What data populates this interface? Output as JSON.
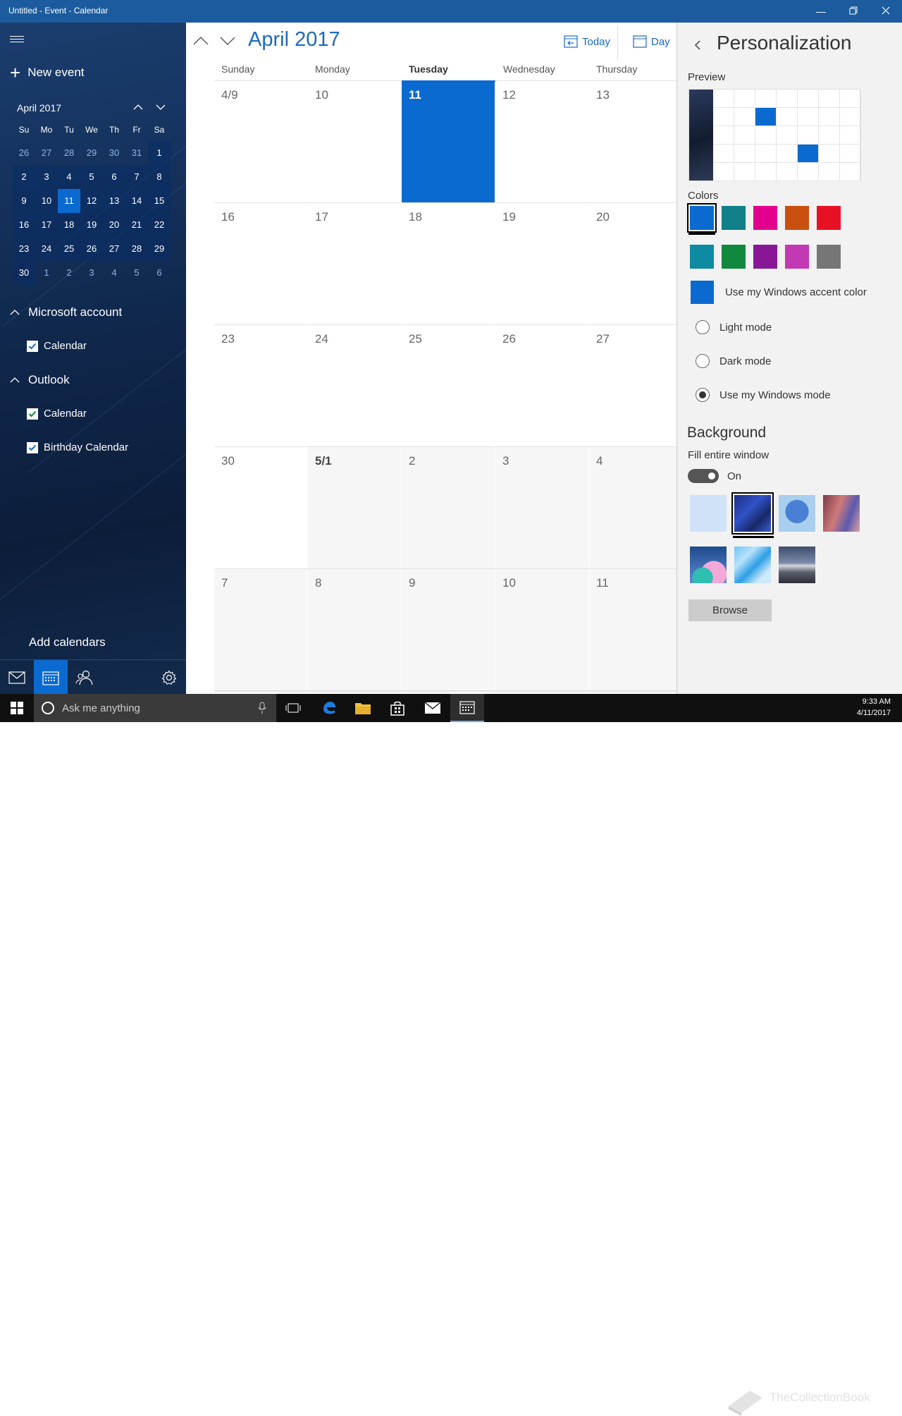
{
  "window": {
    "title": "Untitled - Event - Calendar"
  },
  "sidebar": {
    "new_event": "New event",
    "mini_month": "April 2017",
    "dows": [
      "Su",
      "Mo",
      "Tu",
      "We",
      "Th",
      "Fr",
      "Sa"
    ],
    "days": [
      "26",
      "27",
      "28",
      "29",
      "30",
      "31",
      "1",
      "2",
      "3",
      "4",
      "5",
      "6",
      "7",
      "8",
      "9",
      "10",
      "11",
      "12",
      "13",
      "14",
      "15",
      "16",
      "17",
      "18",
      "19",
      "20",
      "21",
      "22",
      "23",
      "24",
      "25",
      "26",
      "27",
      "28",
      "29",
      "30",
      "1",
      "2",
      "3",
      "4",
      "5",
      "6"
    ],
    "selected_day": "11",
    "accounts": [
      {
        "name": "Microsoft account",
        "calendars": [
          "Calendar"
        ]
      },
      {
        "name": "Outlook",
        "calendars": [
          "Calendar",
          "Birthday Calendar"
        ]
      }
    ],
    "add_calendars": "Add calendars"
  },
  "main": {
    "month_title": "April 2017",
    "today_label": "Today",
    "day_label": "Day",
    "dows": [
      "Sunday",
      "Monday",
      "Tuesday",
      "Wednesday",
      "Thursday"
    ],
    "current_dow": "Tuesday",
    "weeks": [
      [
        "4/9",
        "10",
        "11",
        "12",
        "13"
      ],
      [
        "16",
        "17",
        "18",
        "19",
        "20"
      ],
      [
        "23",
        "24",
        "25",
        "26",
        "27"
      ],
      [
        "30",
        "5/1",
        "2",
        "3",
        "4"
      ],
      [
        "7",
        "8",
        "9",
        "10",
        "11"
      ]
    ],
    "today": "11"
  },
  "panel": {
    "title": "Personalization",
    "preview_label": "Preview",
    "colors_label": "Colors",
    "colors": [
      "#0b6ad0",
      "#118089",
      "#e3008c",
      "#ca5010",
      "#e81123",
      "#0f8aa3",
      "#10893e",
      "#881798",
      "#c239b3",
      "#767676"
    ],
    "accent_label": "Use my Windows accent color",
    "modes": [
      "Light mode",
      "Dark mode",
      "Use my Windows mode"
    ],
    "selected_mode": "Use my Windows mode",
    "background_title": "Background",
    "fill_label": "Fill entire window",
    "toggle_state": "On",
    "browse_label": "Browse"
  },
  "taskbar": {
    "search_placeholder": "Ask me anything",
    "time": "9:33 AM",
    "date": "4/11/2017",
    "watermark": "TheCollectionBook"
  }
}
